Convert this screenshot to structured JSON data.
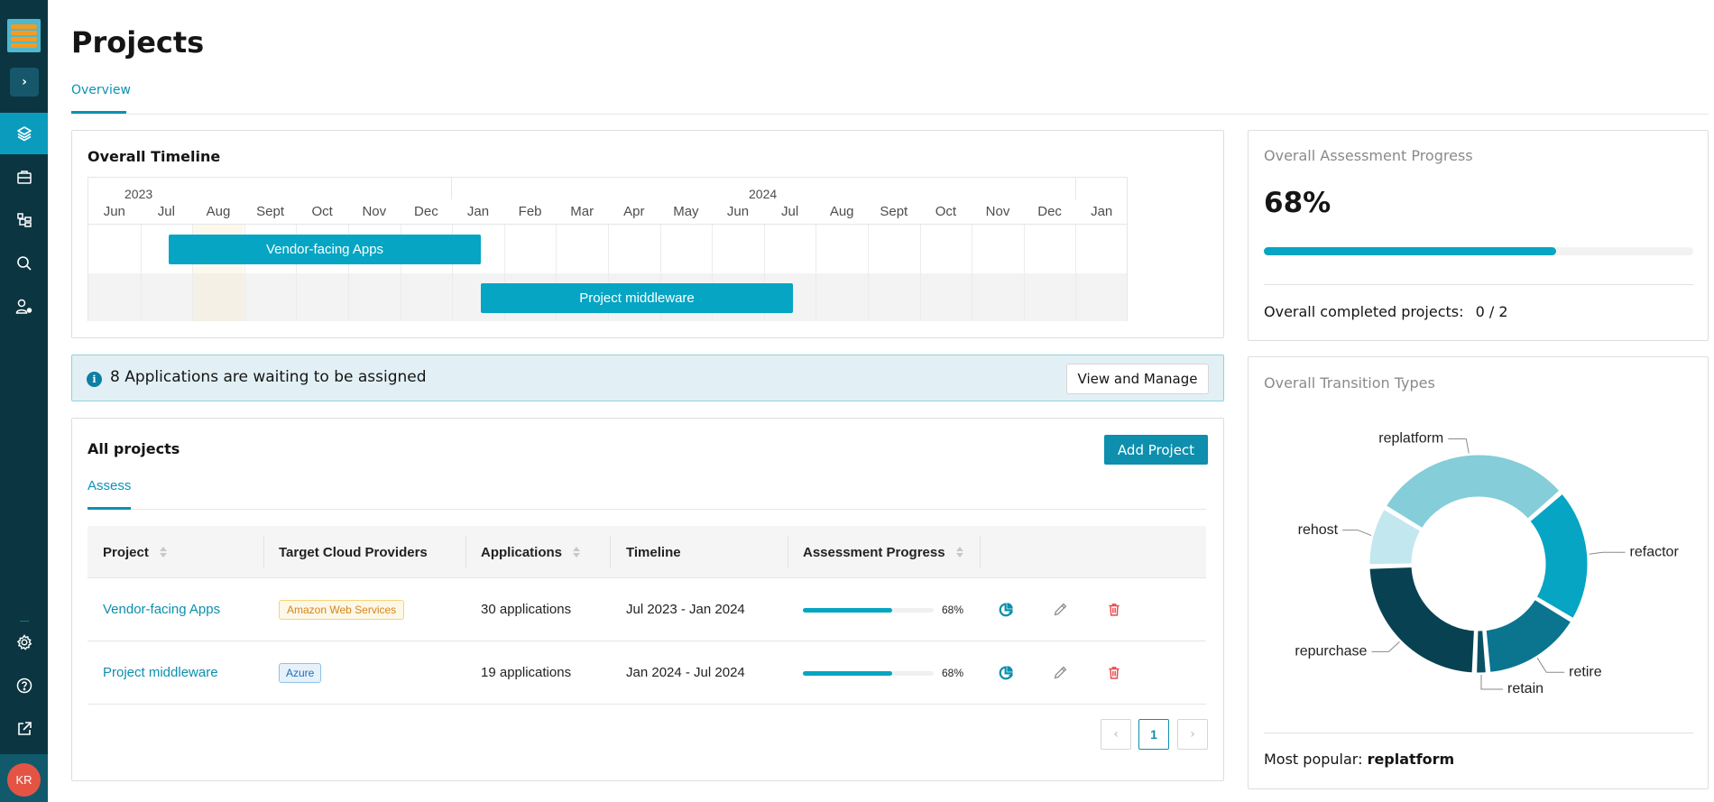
{
  "sidebar": {
    "toggle_icon": "chevron-right-icon",
    "items": [
      {
        "name": "projects",
        "icon": "layers-icon",
        "active": true
      },
      {
        "name": "portfolio",
        "icon": "briefcase-icon",
        "active": false
      },
      {
        "name": "hierarchy",
        "icon": "hierarchy-icon",
        "active": false
      },
      {
        "name": "search",
        "icon": "search-icon",
        "active": false
      },
      {
        "name": "user-settings",
        "icon": "user-gear-icon",
        "active": false
      }
    ],
    "bottom_items": [
      {
        "name": "settings",
        "icon": "gear-icon"
      },
      {
        "name": "help",
        "icon": "help-icon"
      },
      {
        "name": "external-link",
        "icon": "external-link-icon"
      }
    ],
    "avatar_initials": "KR"
  },
  "header": {
    "title": "Projects",
    "tabs": [
      {
        "label": "Overview",
        "active": true
      }
    ]
  },
  "timeline": {
    "title": "Overall Timeline",
    "years": [
      "2023",
      "2024"
    ],
    "months": [
      "Jun",
      "Jul",
      "Aug",
      "Sept",
      "Oct",
      "Nov",
      "Dec",
      "Jan",
      "Feb",
      "Mar",
      "Apr",
      "May",
      "Jun",
      "Jul",
      "Aug",
      "Sept",
      "Oct",
      "Nov",
      "Dec",
      "Jan"
    ],
    "bars": [
      {
        "label": "Vendor-facing Apps",
        "start": "Jul 2023",
        "end": "Jan 2024"
      },
      {
        "label": "Project middleware",
        "start": "Jan 2024",
        "end": "Jul 2024"
      }
    ]
  },
  "alert": {
    "icon": "info-icon",
    "text": "8 Applications are waiting to be assigned",
    "button_label": "View and Manage"
  },
  "projects": {
    "title": "All projects",
    "add_button_label": "Add Project",
    "tabs": [
      {
        "label": "Assess",
        "active": true
      }
    ],
    "columns": [
      "Project",
      "Target Cloud Providers",
      "Applications",
      "Timeline",
      "Assessment Progress"
    ],
    "rows": [
      {
        "project": "Vendor-facing Apps",
        "provider": "Amazon Web Services",
        "provider_type": "aws",
        "applications": "30 applications",
        "timeline": "Jul 2023 - Jan 2024",
        "progress": 68,
        "progress_label": "68%"
      },
      {
        "project": "Project middleware",
        "provider": "Azure",
        "provider_type": "azure",
        "applications": "19 applications",
        "timeline": "Jan 2024 - Jul 2024",
        "progress": 68,
        "progress_label": "68%"
      }
    ],
    "row_actions": [
      "assess-chart-icon",
      "edit-pencil-icon",
      "delete-trash-icon"
    ],
    "pagination": {
      "current_page": "1",
      "prev_icon": "chevron-left-icon",
      "next_icon": "chevron-right-icon"
    }
  },
  "assessment_progress": {
    "title": "Overall Assessment Progress",
    "percent_label": "68%",
    "percent": 68,
    "completed_label": "Overall completed projects:",
    "completed_value": "0 / 2"
  },
  "transition_types": {
    "title": "Overall Transition Types",
    "most_popular_label": "Most popular:",
    "most_popular_value": "replatform"
  },
  "colors": {
    "accent": "#0d8fad",
    "sidebar_bg": "#0c3542",
    "bar": "#06a5c3",
    "danger": "#e8474b"
  },
  "chart_data": {
    "type": "pie",
    "variant": "donut",
    "title": "Overall Transition Types",
    "categories": [
      "replatform",
      "refactor",
      "retire",
      "retain",
      "repurchase",
      "rehost"
    ],
    "values": [
      30,
      20,
      15,
      2,
      24,
      9
    ],
    "unit": "percent (estimated)",
    "colors": [
      "#84cdd9",
      "#06a5c3",
      "#0b7590",
      "#0a5164",
      "#084252",
      "#c3e7ee"
    ],
    "legend": "none (leader-line labels)"
  }
}
